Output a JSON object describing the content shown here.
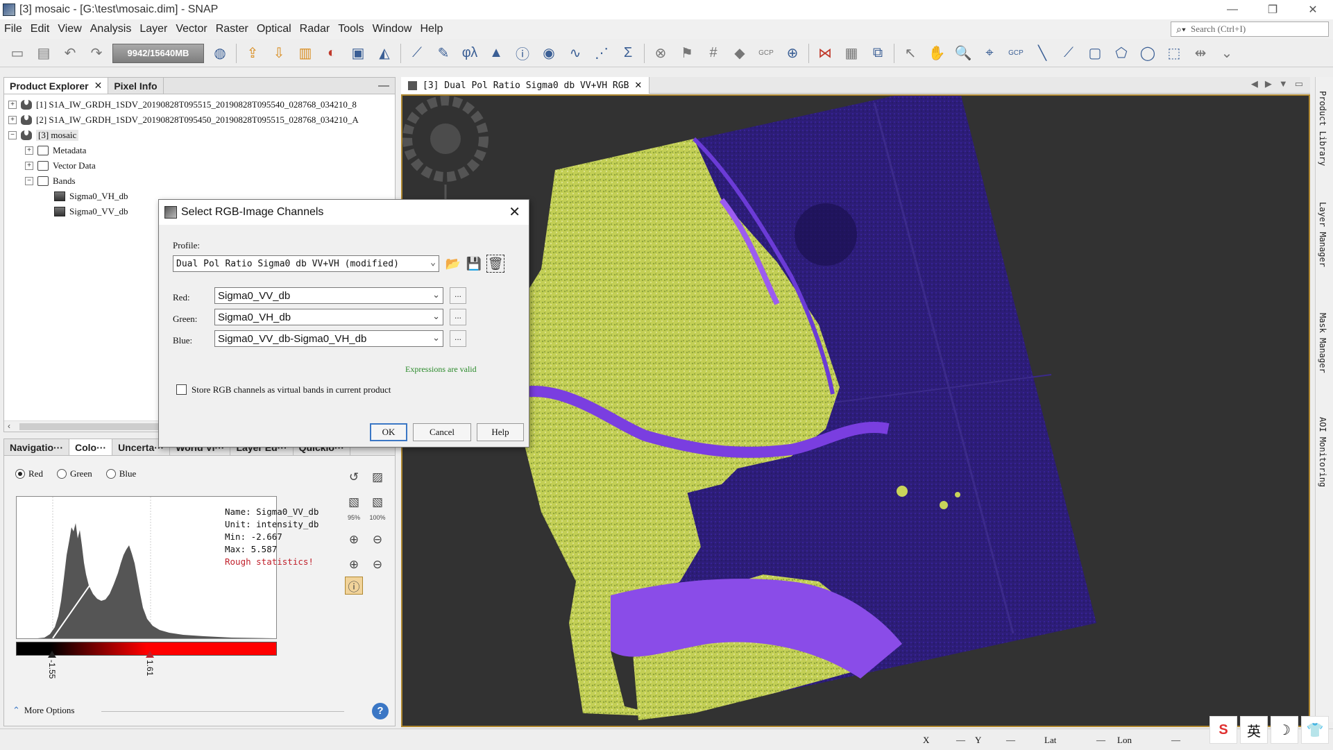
{
  "window": {
    "title": "[3] mosaic - [G:\\test\\mosaic.dim] - SNAP",
    "minimize": "—",
    "restore": "❐",
    "close": "✕"
  },
  "menu": [
    "File",
    "Edit",
    "View",
    "Analysis",
    "Layer",
    "Vector",
    "Raster",
    "Optical",
    "Radar",
    "Tools",
    "Window",
    "Help"
  ],
  "search": {
    "placeholder": "Search (Ctrl+I)"
  },
  "toolbar": {
    "memory": "9942/15640MB",
    "gcp1": "GCP",
    "gcp2": "GCP"
  },
  "product_explorer": {
    "tabs": [
      "Product Explorer",
      "Pixel Info"
    ],
    "tree": [
      {
        "label": "[1] S1A_IW_GRDH_1SDV_20190828T095515_20190828T095540_028768_034210_8"
      },
      {
        "label": "[2] S1A_IW_GRDH_1SDV_20190828T095450_20190828T095515_028768_034210_A"
      },
      {
        "label": "[3] mosaic"
      },
      {
        "label": "Metadata"
      },
      {
        "label": "Vector Data"
      },
      {
        "label": "Bands"
      },
      {
        "label": "Sigma0_VH_db"
      },
      {
        "label": "Sigma0_VV_db"
      }
    ]
  },
  "color_panel": {
    "tabs": [
      "Navigatio···",
      "Colo···",
      "Uncerta···",
      "World Vi···",
      "Layer Ed···",
      "Quicklo···"
    ],
    "channels": [
      "Red",
      "Green",
      "Blue"
    ],
    "info": {
      "name": "Name: Sigma0_VV_db",
      "unit": "Unit: intensity_db",
      "min": "Min: -2.667",
      "max": "Max: 5.587",
      "rough": "Rough statistics!"
    },
    "slider_low": "-1.55",
    "slider_high": "1.61",
    "zoom95": "95%",
    "zoom100": "100%",
    "more_options": "More Options",
    "help": "?"
  },
  "view": {
    "tab_title": "[3] Dual Pol Ratio Sigma0 db VV+VH RGB",
    "close": "✕"
  },
  "right_tabs": [
    "Product Library",
    "Layer Manager",
    "Mask Manager",
    "AOI Monitoring"
  ],
  "dialog": {
    "title": "Select RGB-Image Channels",
    "profile_label": "Profile:",
    "profile_value": "Dual Pol Ratio Sigma0 db VV+VH (modified)",
    "red_label": "Red:",
    "red_value": "Sigma0_VV_db",
    "green_label": "Green:",
    "green_value": "Sigma0_VH_db",
    "blue_label": "Blue:",
    "blue_value": "Sigma0_VV_db-Sigma0_VH_db",
    "valid": "Expressions are valid",
    "store_label": "Store RGB channels as virtual bands in current product",
    "ok": "OK",
    "cancel": "Cancel",
    "help": "Help",
    "dots": "..."
  },
  "status": {
    "x": "X",
    "x_val": "—",
    "y": "Y",
    "y_val": "—",
    "lat": "Lat",
    "lat_val": "—",
    "lon": "Lon",
    "lon_val": "—"
  },
  "ime": [
    "S",
    "英",
    "☽",
    "👕"
  ],
  "colors": {
    "land": "#c9d45a",
    "water": "#2a1b6e",
    "river": "#7a3ee0",
    "accent": "#3b77c5"
  }
}
